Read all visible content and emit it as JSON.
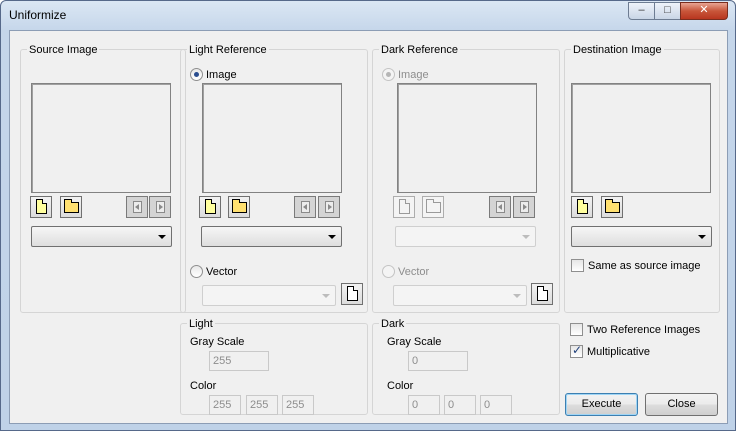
{
  "window": {
    "title": "Uniformize",
    "controls": {
      "minimize": "–",
      "maximize": "□",
      "close": "✕"
    }
  },
  "source": {
    "group_label": "Source Image"
  },
  "light_reference": {
    "group_label": "Light Reference",
    "image_option": "Image",
    "vector_option": "Vector",
    "mode": "image"
  },
  "dark_reference": {
    "group_label": "Dark Reference",
    "image_option": "Image",
    "vector_option": "Vector",
    "mode": "image",
    "enabled": false
  },
  "destination": {
    "group_label": "Destination Image",
    "same_as_source_label": "Same as source image",
    "same_as_source_checked": false
  },
  "light": {
    "group_label": "Light",
    "gray_scale_label": "Gray Scale",
    "gray_scale_value": "255",
    "color_label": "Color",
    "color_values": [
      "255",
      "255",
      "255"
    ]
  },
  "dark": {
    "group_label": "Dark",
    "gray_scale_label": "Gray Scale",
    "gray_scale_value": "0",
    "color_label": "Color",
    "color_values": [
      "0",
      "0",
      "0"
    ]
  },
  "options": {
    "two_reference_label": "Two Reference Images",
    "two_reference_checked": false,
    "multiplicative_label": "Multiplicative",
    "multiplicative_checked": true,
    "check_mark": "✓"
  },
  "buttons": {
    "execute": "Execute",
    "close": "Close"
  },
  "icons": {
    "new": "new-document-icon",
    "open": "open-folder-icon",
    "prev": "previous-icon",
    "next": "next-icon"
  }
}
